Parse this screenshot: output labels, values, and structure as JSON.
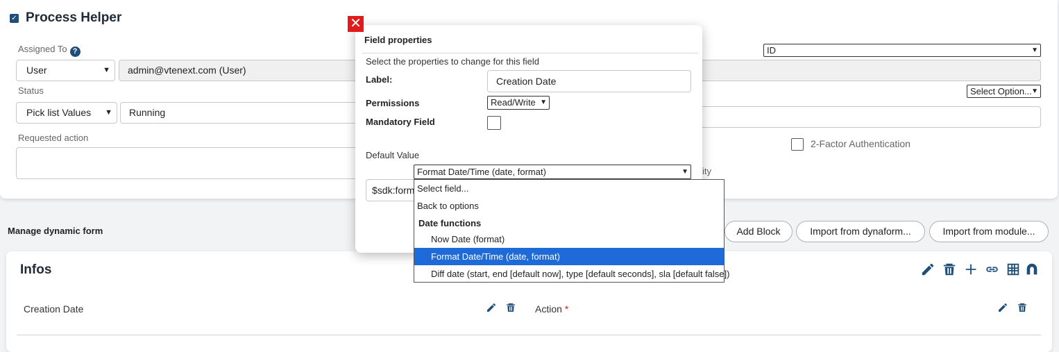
{
  "header": {
    "title": "Process Helper"
  },
  "form": {
    "assigned_to_label": "Assigned To",
    "help_icon_glyph": "?",
    "assigned_type": "User",
    "assigned_value": "admin@vtenext.com (User)",
    "status_label": "Status",
    "status_type": "Pick list Values",
    "status_value": "Running",
    "requested_action_label": "Requested action",
    "id_select": "ID",
    "select_option": "Select Option...",
    "two_factor_label": "2-Factor Authentication",
    "ity_label": "ity"
  },
  "dynamic": {
    "section_title": "Manage dynamic form",
    "add_block": "Add Block",
    "import_dynaform": "Import from dynaform...",
    "import_module": "Import from module..."
  },
  "block": {
    "title": "Infos",
    "field1": "Creation Date",
    "field2": "Action",
    "required_mark": "*"
  },
  "modal": {
    "close_glyph": "✕",
    "title": "Field properties",
    "subtitle": "Select the properties to change for this field",
    "label_label": "Label:",
    "label_value": "Creation Date",
    "permissions_label": "Permissions",
    "permissions_value": "Read/Write",
    "mandatory_label": "Mandatory Field",
    "default_value_label": "Default Value",
    "default_select": "Format Date/Time (date, format)",
    "default_input": "$sdk:form"
  },
  "dropdown": {
    "items": [
      "Select field...",
      "Back to options",
      "Date functions",
      "Now Date (format)",
      "Format Date/Time (date, format)",
      "Diff date (start, end [default now], type [default seconds], sla [default false])"
    ]
  },
  "colors": {
    "accent": "#1f4e79",
    "highlight": "#1e6ad8",
    "close": "#e11b1b"
  }
}
